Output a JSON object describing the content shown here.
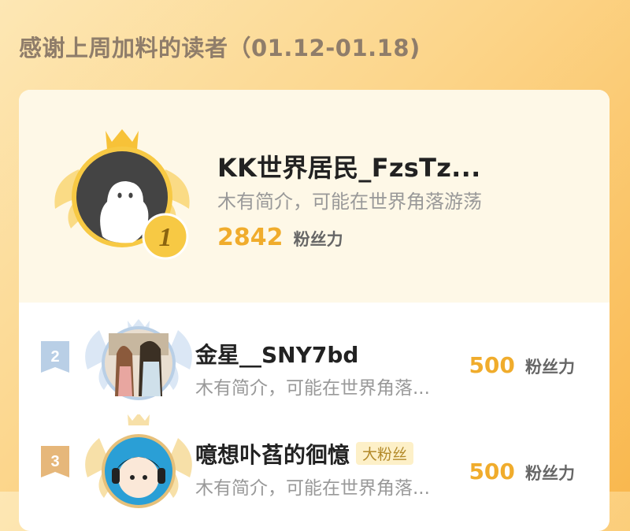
{
  "header": {
    "title": "感谢上周加料的读者（01.12-01.18)"
  },
  "top_reader": {
    "rank": "1",
    "name": "KK世界居民_FzsTz...",
    "bio": "木有简介，可能在世界角落游荡",
    "fans_count": "2842",
    "fans_label": "粉丝力"
  },
  "readers": [
    {
      "rank": "2",
      "name": "金星__SNY7bd",
      "bio": "木有简介，可能在世界角落...",
      "fans_count": "500",
      "fans_label": "粉丝力",
      "tag": ""
    },
    {
      "rank": "3",
      "name": "噫想卟萏的徊憶",
      "bio": "木有简介，可能在世界角落...",
      "fans_count": "500",
      "fans_label": "粉丝力",
      "tag": "大粉丝"
    }
  ],
  "colors": {
    "accent": "#f0ac2c",
    "header_text": "#8f7d6a",
    "rank2": "#b9cfe6",
    "rank3": "#e6b77a"
  }
}
